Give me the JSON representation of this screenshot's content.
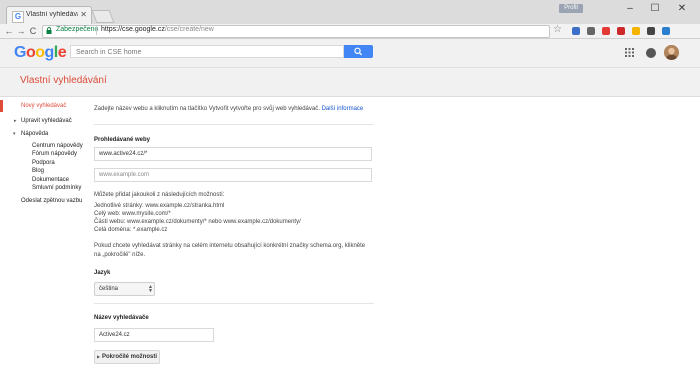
{
  "browser": {
    "tab_title": "Vlastní vyhledávání – vyh",
    "tab_close": "✕",
    "profile": "Profil",
    "window_controls": {
      "minimize": "–",
      "maximize": "☐",
      "close": "✕"
    },
    "nav": {
      "back": "←",
      "forward": "→",
      "reload": "C"
    },
    "secure_label": "Zabezpečeno",
    "url_host": "https://cse.google.cz",
    "url_path": "/cse/create/new",
    "extension_colors": [
      "#3b6fc9",
      "#666666",
      "#e53935",
      "#cc2a2a",
      "#f4b400",
      "#444444",
      "#2a7fd0"
    ]
  },
  "google": {
    "logo": [
      {
        "ch": "G",
        "color": "#4285f4"
      },
      {
        "ch": "o",
        "color": "#ea4335"
      },
      {
        "ch": "o",
        "color": "#fbbc05"
      },
      {
        "ch": "g",
        "color": "#4285f4"
      },
      {
        "ch": "l",
        "color": "#34a853"
      },
      {
        "ch": "e",
        "color": "#ea4335"
      }
    ],
    "search_placeholder": "Search in CSE home"
  },
  "cse": {
    "title": "Vlastní vyhledávání"
  },
  "sidebar": {
    "new_engine": "Nový vyhledávač",
    "edit_engine": "Upravit vyhledávač",
    "help": "Nápověda",
    "help_items": [
      "Centrum nápovědy",
      "Fórum nápovědy",
      "Podpora",
      "Blog",
      "Dokumentace",
      "Smluvní podmínky"
    ],
    "feedback": "Odeslat zpětnou vazbu"
  },
  "form": {
    "intro": "Zadejte název webu a kliknutím na tlačítko Vytvořit vytvořte pro svůj web vyhledávač.",
    "intro_link": "Další informace",
    "sites_heading": "Prohledávané weby",
    "site_value": "www.active24.cz/*",
    "site_placeholder": "www.example.com",
    "patterns_intro": "Můžete přidat jakoukoli z následujících možností:",
    "patterns": [
      "Jednotlivé stránky: www.example.cz/stranka.html",
      "Celý web: www.mysite.com/*",
      "Části webu: www.example.cz/dokumenty/* nebo www.example.cz/dokumenty/",
      "Celá doména: *.example.cz"
    ],
    "schema_note_1": "Pokud chcete vyhledávat stránky na celém internetu obsahující konkrétní značky schema.org, klikněte",
    "schema_note_2": "na „pokročilé\" níže.",
    "language_heading": "Jazyk",
    "language_value": "čeština",
    "name_heading": "Název vyhledávače",
    "name_value": "Active24.cz",
    "advanced_label": "Pokročilé možnosti"
  }
}
